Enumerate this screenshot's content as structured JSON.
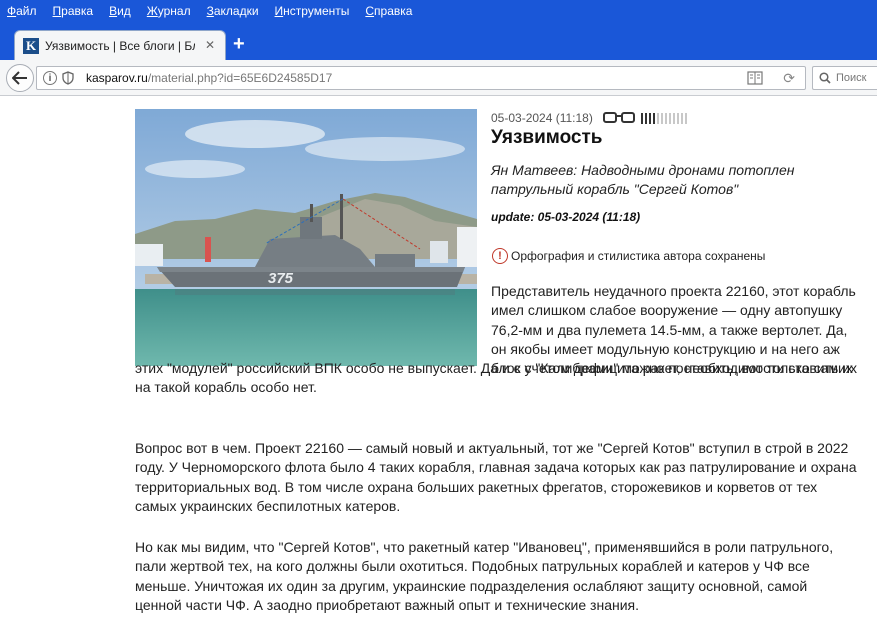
{
  "menu": [
    "Файл",
    "Правка",
    "Вид",
    "Журнал",
    "Закладки",
    "Инструменты",
    "Справка"
  ],
  "tab": {
    "title": "Уязвимость | Все блоги | Бл...",
    "favicon_letter": "K"
  },
  "urlbar": {
    "domain": "kasparov.ru",
    "path": "/material.php?id=65E6D24585D17"
  },
  "search": {
    "placeholder": "Поиск"
  },
  "article": {
    "date": "05-03-2024 (11:18)",
    "title": "Уязвимость",
    "subtitle": "Ян Матвеев: Надводными дронами потоплен патрульный корабль \"Сергей Котов\"",
    "update": "update: 05-03-2024 (11:18)",
    "notice": "Орфография и стилистика автора сохранены",
    "ship_number": "375",
    "paragraph1_lines": [
      "Представитель неудачного проекта 22160, этот корабль",
      "имел слишком слабое вооружение — одну автопушку",
      "76,2-мм и два пулемета 14.5-мм, а также вертолет. Да,",
      "он якобы имеет модульную конструкцию и на него аж",
      "блок с \"Калибрами\" можно поставить, вот только самих"
    ],
    "paragraph1_cont_lines": [
      "этих \"модулей\" российский ВПК особо не выпускает. Да и с учетом дефицита ракет, необходимости ставить их",
      "на такой корабль особо нет."
    ],
    "paragraph2_lines": [
      "Вопрос вот в чем. Проект 22160 — самый новый и актуальный, тот же \"Сергей Котов\" вступил в строй в 2022",
      "году. У Черноморского флота было 4 таких корабля, главная задача которых как раз патрулирование и охрана",
      "территориальных вод. В том числе охрана больших ракетных фрегатов, сторожевиков и корветов от тех",
      "самых украинских беспилотных катеров."
    ],
    "paragraph3_lines": [
      "Но как мы видим, что \"Сергей Котов\", что ракетный катер \"Ивановец\", применявшийся в роли патрульного,",
      "пали жертвой тех, на кого должны были охотиться. Подобных патрульных кораблей и катеров у ЧФ все",
      "меньше. Уничтожая их один за другим, украинские подразделения ослабляют защиту основной, самой",
      "ценной части ЧФ. А заодно приобретают важный опыт и технические знания."
    ]
  },
  "rating": {
    "filled": 4,
    "total": 12
  },
  "colors": {
    "chrome_blue": "#1a57d8",
    "rating_dark": "#333333",
    "rating_light": "#c8c8c8",
    "notice_red": "#c0392b"
  }
}
